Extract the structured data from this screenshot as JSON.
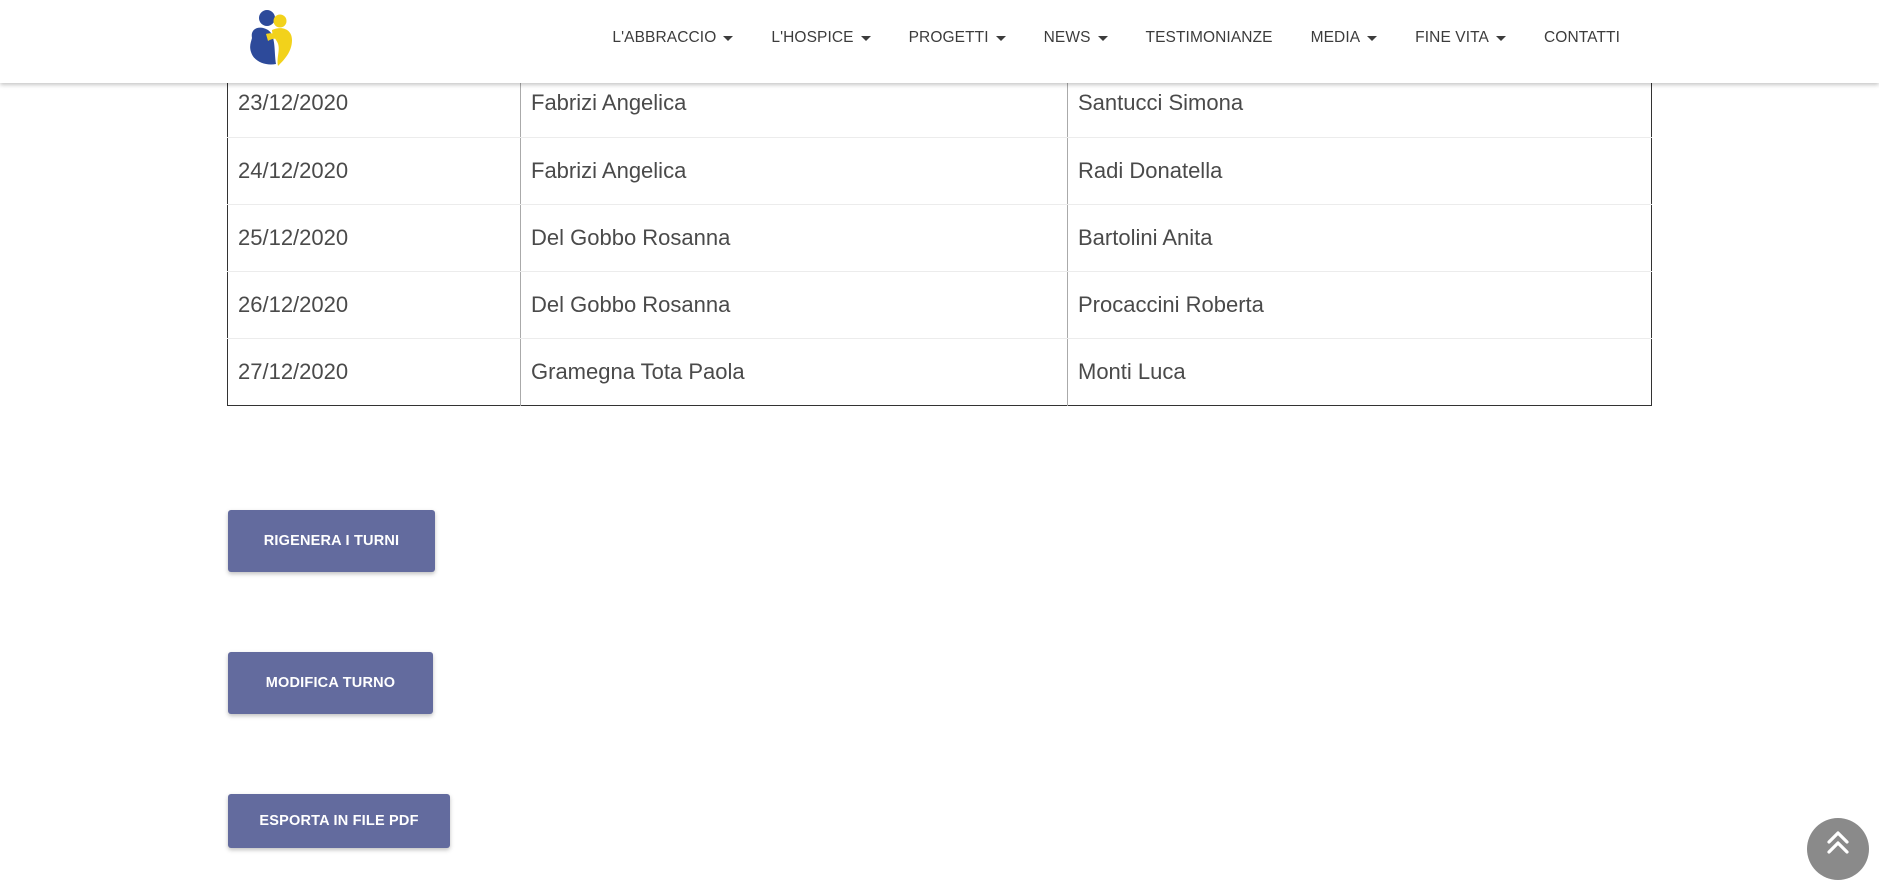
{
  "nav": {
    "items": [
      {
        "label": "L'ABBRACCIO",
        "dropdown": true
      },
      {
        "label": "L'HOSPICE",
        "dropdown": true
      },
      {
        "label": "PROGETTI",
        "dropdown": true
      },
      {
        "label": "NEWS",
        "dropdown": true
      },
      {
        "label": "TESTIMONIANZE",
        "dropdown": false
      },
      {
        "label": "MEDIA",
        "dropdown": true
      },
      {
        "label": "FINE VITA",
        "dropdown": true
      },
      {
        "label": "CONTATTI",
        "dropdown": false
      }
    ]
  },
  "table": {
    "rows": [
      {
        "date": "23/12/2020",
        "first": "Fabrizi Angelica",
        "second": "Santucci Simona"
      },
      {
        "date": "24/12/2020",
        "first": "Fabrizi Angelica",
        "second": "Radi Donatella"
      },
      {
        "date": "25/12/2020",
        "first": "Del Gobbo Rosanna",
        "second": "Bartolini Anita"
      },
      {
        "date": "26/12/2020",
        "first": "Del Gobbo Rosanna",
        "second": "Procaccini Roberta"
      },
      {
        "date": "27/12/2020",
        "first": "Gramegna Tota Paola",
        "second": "Monti Luca"
      }
    ]
  },
  "buttons": {
    "rigenera": "RIGENERA I TURNI",
    "modifica": "MODIFICA TURNO",
    "esporta": "ESPORTA IN FILE PDF"
  },
  "icons": {
    "logo": "logo-icon",
    "scroll_top": "double-chevron-up-icon"
  },
  "colors": {
    "button_bg": "#636b9e",
    "scroll_top_bg": "#8a8a8a",
    "logo_blue": "#2d4a9a",
    "logo_yellow": "#f2d21b"
  }
}
